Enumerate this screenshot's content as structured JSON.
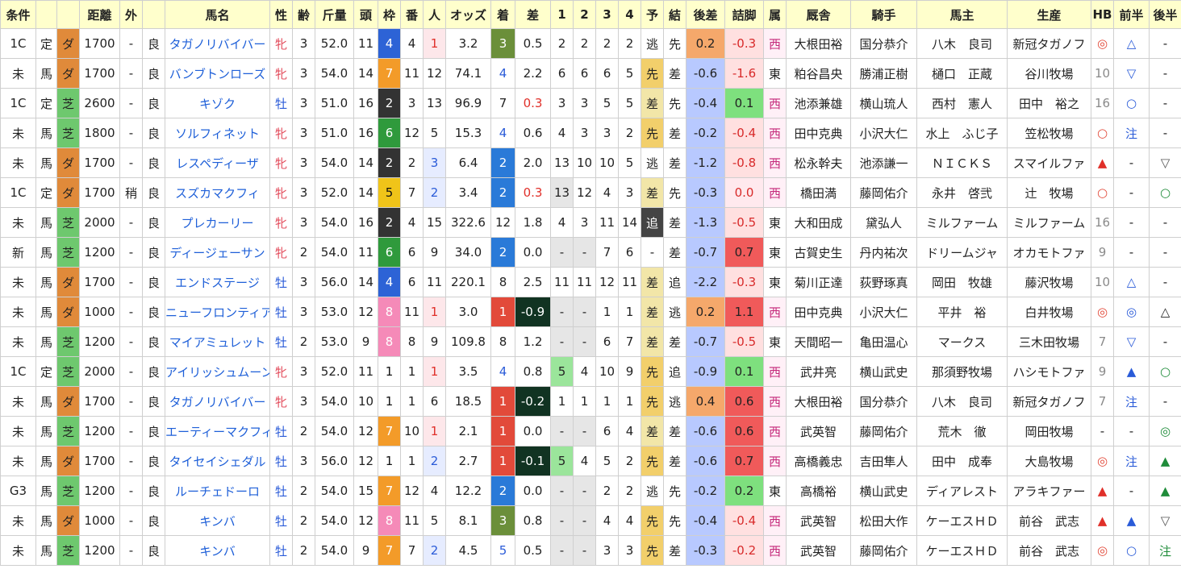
{
  "headers": [
    "条件",
    "",
    "",
    "距離",
    "外",
    "",
    "馬名",
    "性",
    "齢",
    "斤量",
    "頭",
    "枠",
    "番",
    "人",
    "オッズ",
    "着",
    "差",
    "1",
    "2",
    "3",
    "4",
    "予",
    "結",
    "後差",
    "詰脚",
    "属",
    "厩舎",
    "騎手",
    "馬主",
    "生産",
    "HB",
    "前半",
    "後半"
  ],
  "rows": [
    [
      "1C",
      "定",
      "ダ",
      "1700",
      "-",
      "良",
      "タガノリバイバー",
      "牝",
      "3",
      "52.0",
      "11",
      "4",
      "4",
      "1",
      "3.2",
      "3",
      "0.5",
      "2",
      "2",
      "2",
      "2",
      "逃",
      "先",
      "0.2",
      "-0.3",
      "西",
      "大根田裕",
      "国分恭介",
      "八木　良司",
      "新冠タガノフ",
      "◎",
      "△",
      "-"
    ],
    [
      "未",
      "馬",
      "ダ",
      "1700",
      "-",
      "良",
      "バンブトンローズ",
      "牝",
      "3",
      "54.0",
      "14",
      "7",
      "11",
      "12",
      "74.1",
      "4",
      "2.2",
      "6",
      "6",
      "6",
      "5",
      "先",
      "差",
      "-0.6",
      "-1.6",
      "東",
      "粕谷昌央",
      "勝浦正樹",
      "樋口　正蔵",
      "谷川牧場",
      "10",
      "▽",
      "-"
    ],
    [
      "1C",
      "定",
      "芝",
      "2600",
      "-",
      "良",
      "キゾク",
      "牡",
      "3",
      "51.0",
      "16",
      "2",
      "3",
      "13",
      "96.9",
      "7",
      "0.3",
      "3",
      "3",
      "5",
      "5",
      "差",
      "先",
      "-0.4",
      "0.1",
      "西",
      "池添兼雄",
      "横山琉人",
      "西村　憲人",
      "田中　裕之",
      "16",
      "○",
      "-"
    ],
    [
      "未",
      "馬",
      "芝",
      "1800",
      "-",
      "良",
      "ソルフィネット",
      "牝",
      "3",
      "51.0",
      "16",
      "6",
      "12",
      "5",
      "15.3",
      "4",
      "0.6",
      "4",
      "3",
      "3",
      "2",
      "先",
      "差",
      "-0.2",
      "-0.4",
      "西",
      "田中克典",
      "小沢大仁",
      "水上　ふじ子",
      "笠松牧場",
      "○",
      "注",
      "-"
    ],
    [
      "未",
      "馬",
      "ダ",
      "1700",
      "-",
      "良",
      "レスペディーザ",
      "牝",
      "3",
      "54.0",
      "14",
      "2",
      "2",
      "3",
      "6.4",
      "2",
      "2.0",
      "13",
      "10",
      "10",
      "5",
      "逃",
      "差",
      "-1.2",
      "-0.8",
      "西",
      "松永幹夫",
      "池添謙一",
      "ＮＩＣＫＳ",
      "スマイルファ",
      "▲",
      "-",
      "▽"
    ],
    [
      "1C",
      "定",
      "ダ",
      "1700",
      "稍",
      "良",
      "スズカマクフィ",
      "牝",
      "3",
      "52.0",
      "14",
      "5",
      "7",
      "2",
      "3.4",
      "2",
      "0.3",
      "13",
      "12",
      "4",
      "3",
      "差",
      "先",
      "-0.3",
      "0.0",
      "西",
      "橋田満",
      "藤岡佑介",
      "永井　啓弐",
      "辻　牧場",
      "○",
      "-",
      "○"
    ],
    [
      "未",
      "馬",
      "芝",
      "2000",
      "-",
      "良",
      "プレカーリー",
      "牝",
      "3",
      "54.0",
      "16",
      "2",
      "4",
      "15",
      "322.6",
      "12",
      "1.8",
      "4",
      "3",
      "11",
      "14",
      "追",
      "差",
      "-1.3",
      "-0.5",
      "東",
      "大和田成",
      "黛弘人",
      "ミルファーム",
      "ミルファーム",
      "16",
      "-",
      "-"
    ],
    [
      "新",
      "馬",
      "芝",
      "1200",
      "-",
      "良",
      "ディージェーサン",
      "牝",
      "2",
      "54.0",
      "11",
      "6",
      "6",
      "9",
      "34.0",
      "2",
      "0.0",
      "-",
      "-",
      "7",
      "6",
      "-",
      "差",
      "-0.7",
      "0.7",
      "東",
      "古賀史生",
      "丹内祐次",
      "ドリームジャ",
      "オカモトファ",
      "9",
      "-",
      "-"
    ],
    [
      "未",
      "馬",
      "ダ",
      "1700",
      "-",
      "良",
      "エンドステージ",
      "牡",
      "3",
      "56.0",
      "14",
      "4",
      "6",
      "11",
      "220.1",
      "8",
      "2.5",
      "11",
      "11",
      "12",
      "11",
      "差",
      "追",
      "-2.2",
      "-0.3",
      "東",
      "菊川正達",
      "荻野琢真",
      "岡田　牧雄",
      "藤沢牧場",
      "10",
      "△",
      "-"
    ],
    [
      "未",
      "馬",
      "ダ",
      "1000",
      "-",
      "良",
      "ニューフロンティア",
      "牡",
      "3",
      "53.0",
      "12",
      "8",
      "11",
      "1",
      "3.0",
      "1",
      "-0.9",
      "-",
      "-",
      "1",
      "1",
      "差",
      "逃",
      "0.2",
      "1.1",
      "西",
      "田中克典",
      "小沢大仁",
      "平井　裕",
      "白井牧場",
      "◎",
      "◎",
      "△"
    ],
    [
      "未",
      "馬",
      "芝",
      "1200",
      "-",
      "良",
      "マイアミュレット",
      "牡",
      "2",
      "53.0",
      "9",
      "8",
      "8",
      "9",
      "109.8",
      "8",
      "1.2",
      "-",
      "-",
      "6",
      "7",
      "差",
      "差",
      "-0.7",
      "-0.5",
      "東",
      "天間昭一",
      "亀田温心",
      "マークス",
      "三木田牧場",
      "7",
      "▽",
      "-"
    ],
    [
      "1C",
      "定",
      "芝",
      "2000",
      "-",
      "良",
      "アイリッシュムーン",
      "牝",
      "3",
      "52.0",
      "11",
      "1",
      "1",
      "1",
      "3.5",
      "4",
      "0.8",
      "5",
      "4",
      "10",
      "9",
      "先",
      "追",
      "-0.9",
      "0.1",
      "西",
      "武井亮",
      "横山武史",
      "那須野牧場",
      "ハシモトファ",
      "9",
      "▲",
      "○"
    ],
    [
      "未",
      "馬",
      "ダ",
      "1700",
      "-",
      "良",
      "タガノリバイバー",
      "牝",
      "3",
      "54.0",
      "10",
      "1",
      "1",
      "6",
      "18.5",
      "1",
      "-0.2",
      "1",
      "1",
      "1",
      "1",
      "先",
      "逃",
      "0.4",
      "0.6",
      "西",
      "大根田裕",
      "国分恭介",
      "八木　良司",
      "新冠タガノフ",
      "7",
      "注",
      "-"
    ],
    [
      "未",
      "馬",
      "芝",
      "1200",
      "-",
      "良",
      "エーティーマクフィ",
      "牡",
      "2",
      "54.0",
      "12",
      "7",
      "10",
      "1",
      "2.1",
      "1",
      "0.0",
      "-",
      "-",
      "6",
      "4",
      "差",
      "差",
      "-0.6",
      "0.6",
      "西",
      "武英智",
      "藤岡佑介",
      "荒木　徹",
      "岡田牧場",
      "-",
      "-",
      "◎"
    ],
    [
      "未",
      "馬",
      "ダ",
      "1700",
      "-",
      "良",
      "タイセイシェダル",
      "牡",
      "3",
      "56.0",
      "12",
      "1",
      "1",
      "2",
      "2.7",
      "1",
      "-0.1",
      "5",
      "4",
      "5",
      "2",
      "先",
      "差",
      "-0.6",
      "0.7",
      "西",
      "高橋義忠",
      "吉田隼人",
      "田中　成奉",
      "大島牧場",
      "◎",
      "注",
      "▲"
    ],
    [
      "G3",
      "馬",
      "芝",
      "1200",
      "-",
      "良",
      "ルーチェドーロ",
      "牡",
      "2",
      "54.0",
      "15",
      "7",
      "12",
      "4",
      "12.2",
      "2",
      "0.0",
      "-",
      "-",
      "2",
      "2",
      "逃",
      "先",
      "-0.2",
      "0.2",
      "東",
      "高橋裕",
      "横山武史",
      "ディアレスト",
      "アラキファー",
      "▲",
      "-",
      "▲"
    ],
    [
      "未",
      "馬",
      "ダ",
      "1000",
      "-",
      "良",
      "キンバ",
      "牡",
      "2",
      "54.0",
      "12",
      "8",
      "11",
      "5",
      "8.1",
      "3",
      "0.8",
      "-",
      "-",
      "4",
      "4",
      "先",
      "先",
      "-0.4",
      "-0.4",
      "西",
      "武英智",
      "松田大作",
      "ケーエスＨＤ",
      "前谷　武志",
      "▲",
      "▲",
      "▽"
    ],
    [
      "未",
      "馬",
      "芝",
      "1200",
      "-",
      "良",
      "キンバ",
      "牡",
      "2",
      "54.0",
      "9",
      "7",
      "7",
      "2",
      "4.5",
      "5",
      "0.5",
      "-",
      "-",
      "3",
      "3",
      "先",
      "差",
      "-0.3",
      "-0.2",
      "西",
      "武英智",
      "藤岡佑介",
      "ケーエスＨＤ",
      "前谷　武志",
      "◎",
      "○",
      "注"
    ]
  ],
  "colors": {
    "header_bg": "#ffffcc",
    "waku": {
      "1": "#ffffff",
      "2": "#333333",
      "3": "#e44b4b",
      "4": "#2d63d6",
      "5": "#f0c419",
      "6": "#2f9a3c",
      "7": "#f39b29",
      "8": "#f58ab8"
    },
    "finish": {
      "1": "#e24a3a",
      "2": "#2a7ad8",
      "3": "#6b8f3a"
    },
    "kouzasa_pos": "#f5a86b",
    "kouzasa_neg": "#b8c9ff",
    "tsumeashi_pos": "#f05a5a",
    "tsumeashi_neg": "#ffe0e0",
    "tsumeashi_mid": "#7ee07e"
  }
}
